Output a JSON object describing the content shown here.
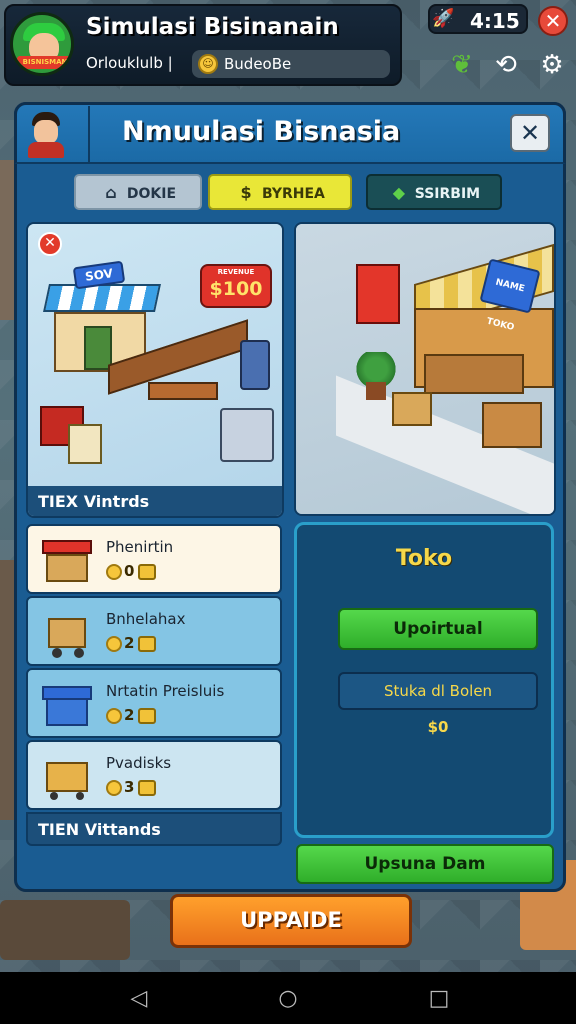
{
  "topbar": {
    "title": "Simulasi Bisinanain",
    "subtitle": "Orlouklulb |",
    "coin_label": "BudeoBe",
    "avatar_tag": "BISNISMAN",
    "time": "4:15"
  },
  "panel": {
    "title": "Nmuulasi Bisnasia",
    "tabs": [
      {
        "label": "DOKIE",
        "icon": "store-icon"
      },
      {
        "label": "BYRHEA",
        "icon": "money-icon"
      },
      {
        "label": "SSIRBIM",
        "icon": "diamond-icon"
      }
    ]
  },
  "left_card": {
    "shop_sign": "SOV",
    "price": "$100",
    "tier_label": "TIEX Vintrds"
  },
  "right_card": {
    "stand_sign": "NAME TOKO",
    "small_sign": "TOKO"
  },
  "list": [
    {
      "name": "Phenirtin",
      "stat1": "0",
      "icon": "market-stall-icon"
    },
    {
      "name": "Bnhelahax",
      "stat1": "2",
      "icon": "cart-icon"
    },
    {
      "name": "Nrtatin Preisluis",
      "stat1": "2",
      "icon": "warehouse-icon"
    },
    {
      "name": "Pvadisks",
      "stat1": "3",
      "icon": "basket-icon"
    }
  ],
  "tier_label_bottom": "TIEN Vittands",
  "info": {
    "title": "Toko",
    "upgrade_label": "Upoirtual",
    "stock_label": "Stuka dl Bolen",
    "stock_value": "$0",
    "bottom_button": "Upsuna Dam"
  },
  "main_button": "UPPAIDE"
}
